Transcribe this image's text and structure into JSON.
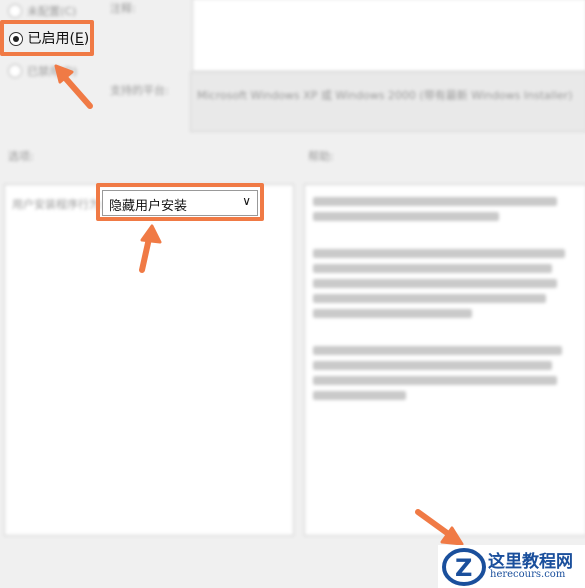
{
  "options": {
    "not_configured": "未配置(C)",
    "enabled_label": "已启用(",
    "enabled_hotkey": "E",
    "enabled_close": ")",
    "disabled": "已禁用(D)"
  },
  "top": {
    "comment_label": "注释:",
    "supported_label": "支持的平台:",
    "supported_text": "Microsoft Windows XP 或 Windows 2000 (带有最新 Windows Installer)"
  },
  "options_section": {
    "label": "选项:",
    "dropdown_label": "用户安装程序行为:",
    "dropdown_value": "隐藏用户安装",
    "dropdown_arrow": "∨"
  },
  "help_section": {
    "label": "帮助:"
  },
  "watermark": {
    "title": "这里教程网",
    "url": "herecours.com",
    "logo_letter": "Z"
  },
  "colors": {
    "highlight": "#f07a45",
    "watermark_blue": "#1a4f9c"
  }
}
